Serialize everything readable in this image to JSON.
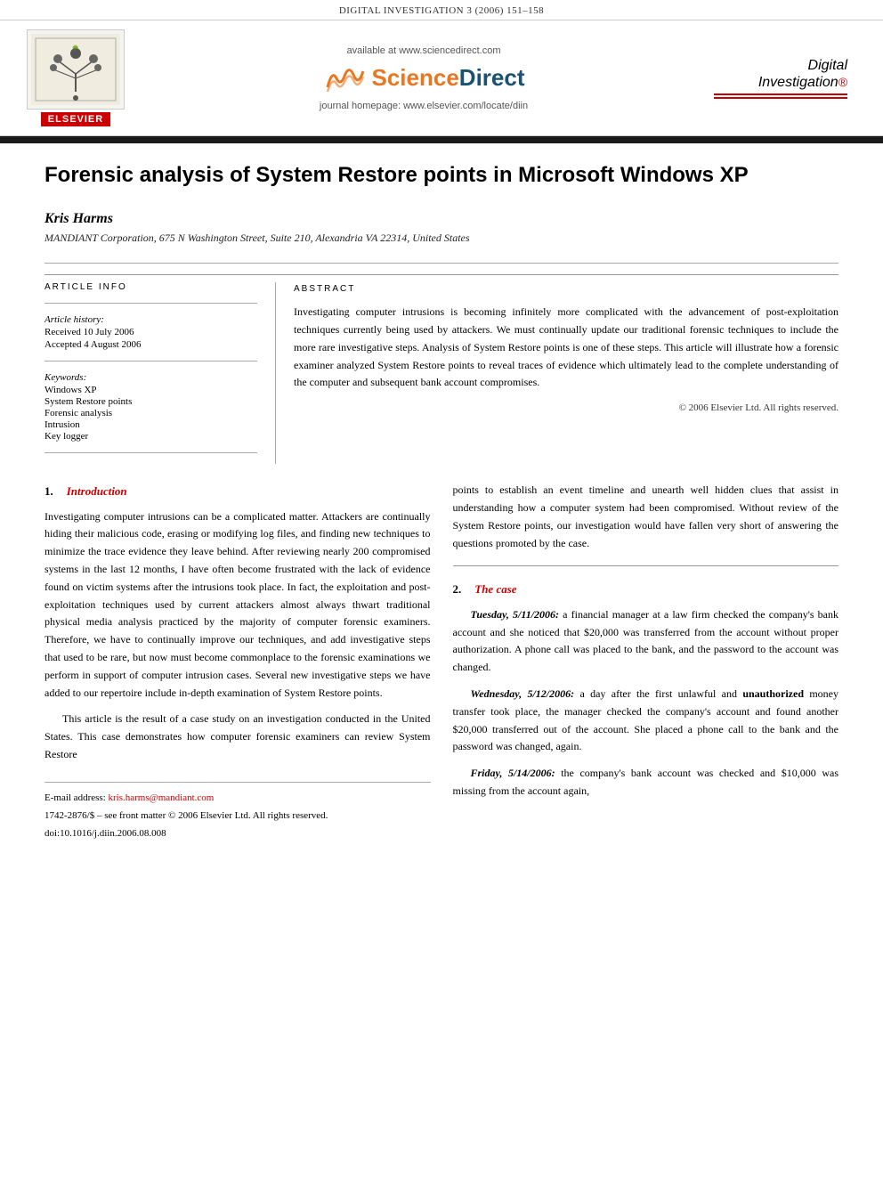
{
  "journal": {
    "header_text": "DIGITAL INVESTIGATION 3 (2006) 151–158",
    "available_text": "available at www.sciencedirect.com",
    "journal_homepage": "journal homepage: www.elsevier.com/locate/diin",
    "elsevier_label": "ELSEVIER",
    "di_logo_line1": "Digital",
    "di_logo_line2": "Investigation"
  },
  "article": {
    "title": "Forensic analysis of System Restore points in Microsoft Windows XP",
    "author": "Kris Harms",
    "affiliation": "MANDIANT Corporation, 675 N Washington Street, Suite 210, Alexandria VA 22314, United States"
  },
  "article_info": {
    "col_header": "ARTICLE INFO",
    "history_label": "Article history:",
    "received": "Received 10 July 2006",
    "accepted": "Accepted 4 August 2006",
    "keywords_label": "Keywords:",
    "keywords": [
      "Windows XP",
      "System Restore points",
      "Forensic analysis",
      "Intrusion",
      "Key logger"
    ]
  },
  "abstract": {
    "col_header": "ABSTRACT",
    "text": "Investigating computer intrusions is becoming infinitely more complicated with the advancement of post-exploitation techniques currently being used by attackers. We must continually update our traditional forensic techniques to include the more rare investigative steps. Analysis of System Restore points is one of these steps. This article will illustrate how a forensic examiner analyzed System Restore points to reveal traces of evidence which ultimately lead to the complete understanding of the computer and subsequent bank account compromises.",
    "copyright": "© 2006 Elsevier Ltd. All rights reserved."
  },
  "section1": {
    "number": "1.",
    "title": "Introduction",
    "paragraphs": [
      "Investigating computer intrusions can be a complicated matter. Attackers are continually hiding their malicious code, erasing or modifying log files, and finding new techniques to minimize the trace evidence they leave behind. After reviewing nearly 200 compromised systems in the last 12 months, I have often become frustrated with the lack of evidence found on victim systems after the intrusions took place. In fact, the exploitation and post-exploitation techniques used by current attackers almost always thwart traditional physical media analysis practiced by the majority of computer forensic examiners. Therefore, we have to continually improve our techniques, and add investigative steps that used to be rare, but now must become commonplace to the forensic examinations we perform in support of computer intrusion cases. Several new investigative steps we have added to our repertoire include in-depth examination of System Restore points.",
      "This article is the result of a case study on an investigation conducted in the United States. This case demonstrates how computer forensic examiners can review System Restore"
    ],
    "continuation": "points to establish an event timeline and unearth well hidden clues that assist in understanding how a computer system had been compromised. Without review of the System Restore points, our investigation would have fallen very short of answering the questions promoted by the case."
  },
  "section2": {
    "number": "2.",
    "title": "The case",
    "paragraphs": [
      "Tuesday, 5/11/2006: a financial manager at a law firm checked the company's bank account and she noticed that $20,000 was transferred from the account without proper authorization. A phone call was placed to the bank, and the password to the account was changed.",
      "Wednesday, 5/12/2006: a day after the first unlawful and unauthorized money transfer took place, the manager checked the company's account and found another $20,000 transferred out of the account. She placed a phone call to the bank and the password was changed, again.",
      "Friday, 5/14/2006: the company's bank account was checked and $10,000 was missing from the account again,"
    ]
  },
  "footnotes": {
    "email_label": "E-mail address:",
    "email": "kris.harms@mandiant.com",
    "issn": "1742-2876/$ – see front matter © 2006 Elsevier Ltd. All rights reserved.",
    "doi": "doi:10.1016/j.diin.2006.08.008"
  }
}
